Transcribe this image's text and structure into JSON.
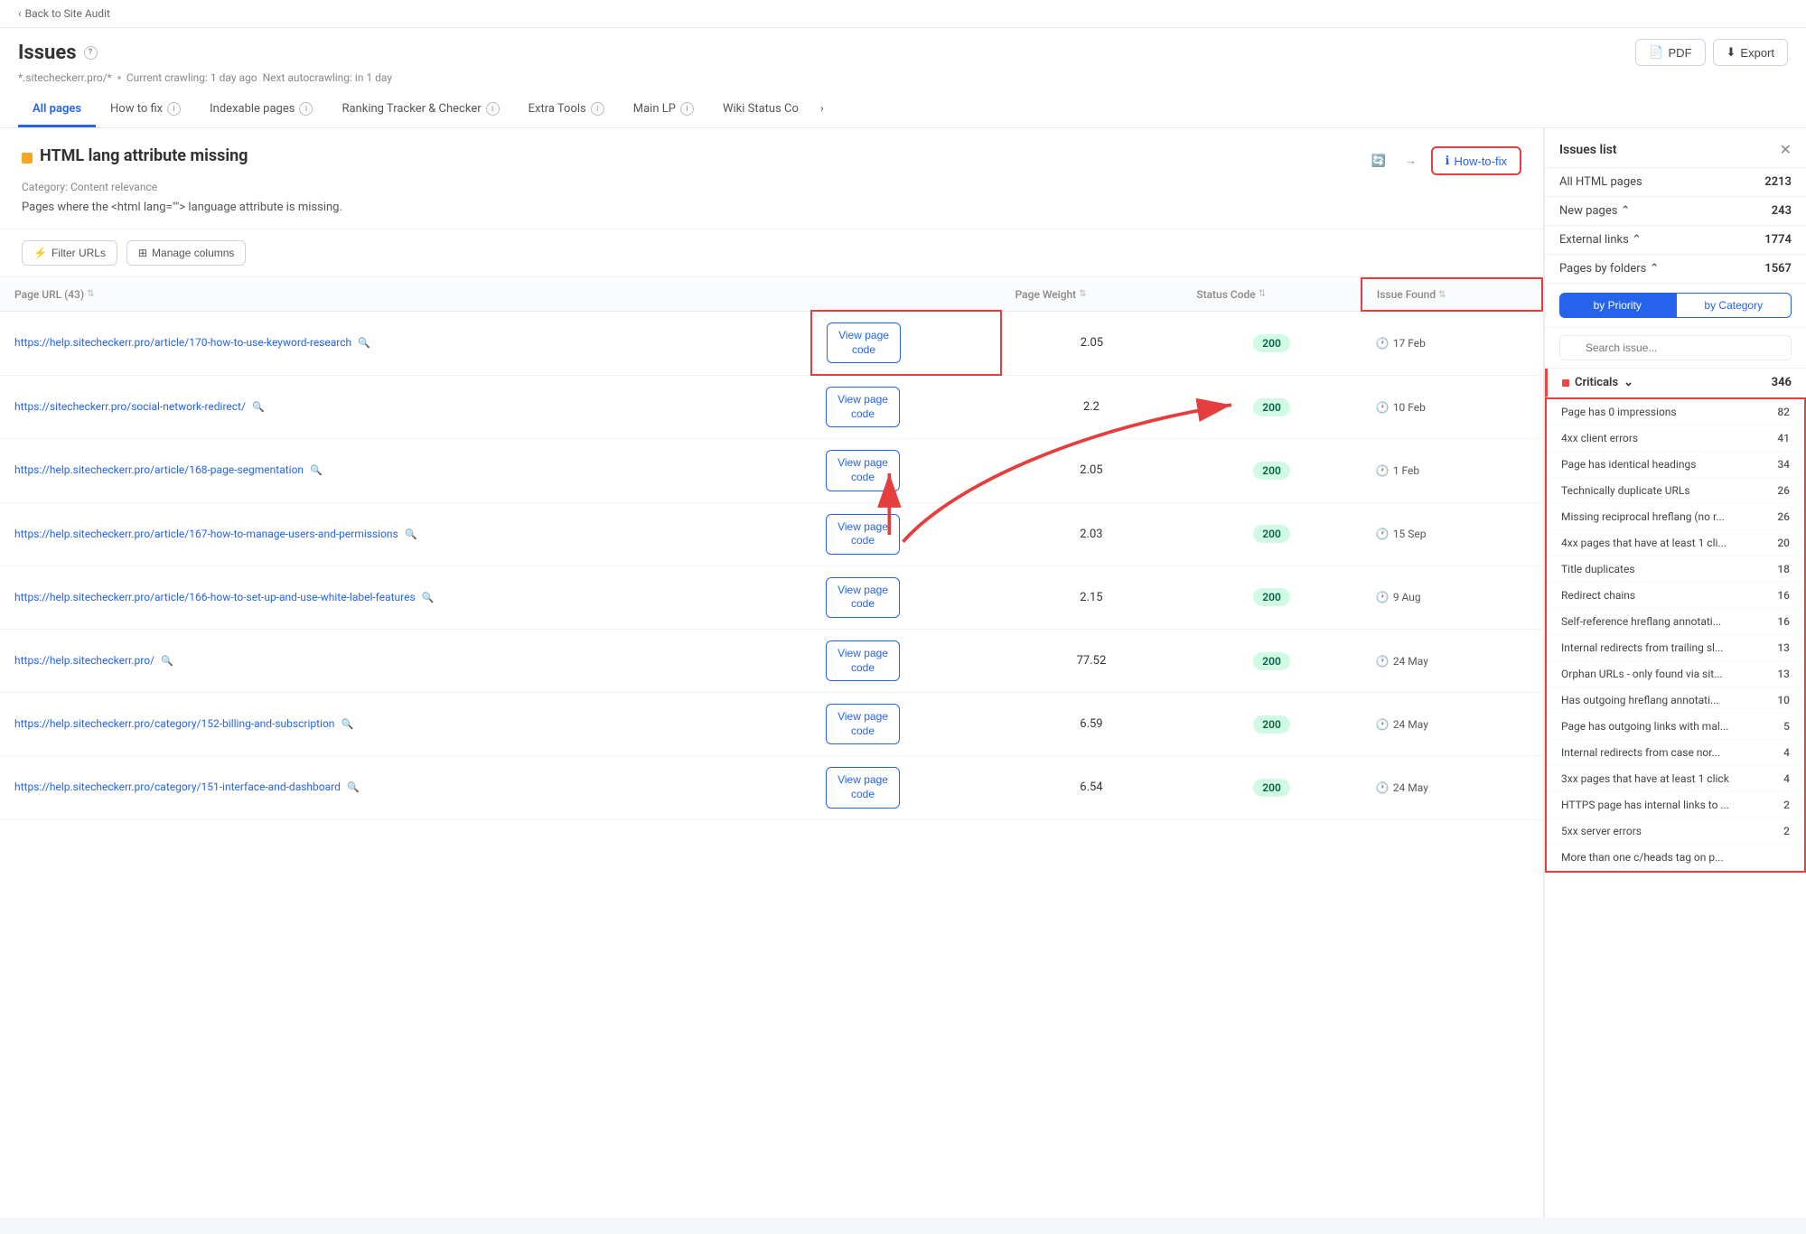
{
  "topbar": {
    "back_label": "Back to Site Audit"
  },
  "header": {
    "title": "Issues",
    "meta_site": "*.sitecheckerr.pro/*",
    "meta_crawling": "Current crawling: 1 day ago",
    "meta_autocrawling": "Next autocrawling: in 1 day",
    "pdf_label": "PDF",
    "export_label": "Export"
  },
  "tabs": [
    {
      "label": "All pages",
      "active": true,
      "has_info": false
    },
    {
      "label": "How to fix",
      "active": false,
      "has_info": true
    },
    {
      "label": "Indexable pages",
      "active": false,
      "has_info": true
    },
    {
      "label": "Ranking Tracker & Checker",
      "active": false,
      "has_info": true
    },
    {
      "label": "Extra Tools",
      "active": false,
      "has_info": true
    },
    {
      "label": "Main LP",
      "active": false,
      "has_info": true
    },
    {
      "label": "Wiki Status Co",
      "active": false,
      "has_info": false
    }
  ],
  "issue": {
    "title": "HTML lang attribute missing",
    "category": "Category: Content relevance",
    "description": "Pages where the <html lang=\"\"> language attribute is missing.",
    "how_to_fix_label": "How-to-fix"
  },
  "toolbar": {
    "filter_label": "Filter URLs",
    "columns_label": "Manage columns"
  },
  "table": {
    "columns": [
      {
        "label": "Page URL (43)",
        "sortable": true
      },
      {
        "label": "",
        "sortable": false
      },
      {
        "label": "Page Weight",
        "sortable": true
      },
      {
        "label": "Status Code",
        "sortable": true
      },
      {
        "label": "Issue Found",
        "sortable": true
      }
    ],
    "rows": [
      {
        "url": "https://help.sitecheckerr.pro/article/170-how-to-use-keyword-research",
        "btn_label": "View page\ncode",
        "weight": "2.05",
        "status": "200",
        "date": "17 Feb"
      },
      {
        "url": "https://sitecheckerr.pro/social-network-redirect/",
        "btn_label": "View page\ncode",
        "weight": "2.2",
        "status": "200",
        "date": "10 Feb"
      },
      {
        "url": "https://help.sitecheckerr.pro/article/168-page-segmentation",
        "btn_label": "View page\ncode",
        "weight": "2.05",
        "status": "200",
        "date": "1 Feb"
      },
      {
        "url": "https://help.sitecheckerr.pro/article/167-how-to-manage-users-and-permissions",
        "btn_label": "View page\ncode",
        "weight": "2.03",
        "status": "200",
        "date": "15 Sep"
      },
      {
        "url": "https://help.sitecheckerr.pro/article/166-how-to-set-up-and-use-white-label-features",
        "btn_label": "View page\ncode",
        "weight": "2.15",
        "status": "200",
        "date": "9 Aug"
      },
      {
        "url": "https://help.sitecheckerr.pro/",
        "btn_label": "View page\ncode",
        "weight": "77.52",
        "status": "200",
        "date": "24 May"
      },
      {
        "url": "https://help.sitecheckerr.pro/category/152-billing-and-subscription",
        "btn_label": "View page\ncode",
        "weight": "6.59",
        "status": "200",
        "date": "24 May"
      },
      {
        "url": "https://help.sitecheckerr.pro/category/151-interface-and-dashboard",
        "btn_label": "View page\ncode",
        "weight": "6.54",
        "status": "200",
        "date": "24 May"
      }
    ]
  },
  "right_panel": {
    "title": "Issues list",
    "all_pages_label": "All HTML pages",
    "all_pages_count": "2213",
    "new_pages_label": "New pages",
    "new_pages_count": "243",
    "external_links_label": "External links",
    "external_links_count": "1774",
    "pages_by_folders_label": "Pages by folders",
    "pages_by_folders_count": "1567",
    "by_priority_label": "by Priority",
    "by_category_label": "by Category",
    "search_placeholder": "Search issue...",
    "criticals_label": "Criticals",
    "criticals_count": "346",
    "issues": [
      {
        "label": "Page has 0 impressions",
        "count": "82"
      },
      {
        "label": "4xx client errors",
        "count": "41"
      },
      {
        "label": "Page has identical headings",
        "count": "34"
      },
      {
        "label": "Technically duplicate URLs",
        "count": "26"
      },
      {
        "label": "Missing reciprocal hreflang (no r...",
        "count": "26"
      },
      {
        "label": "4xx pages that have at least 1 cli...",
        "count": "20"
      },
      {
        "label": "Title duplicates",
        "count": "18"
      },
      {
        "label": "Redirect chains",
        "count": "16"
      },
      {
        "label": "Self-reference hreflang annotati...",
        "count": "16"
      },
      {
        "label": "Internal redirects from trailing sl...",
        "count": "13"
      },
      {
        "label": "Orphan URLs - only found via sit...",
        "count": "13"
      },
      {
        "label": "Has outgoing hreflang annotati...",
        "count": "10"
      },
      {
        "label": "Page has outgoing links with mal...",
        "count": "5"
      },
      {
        "label": "Internal redirects from case nor...",
        "count": "4"
      },
      {
        "label": "3xx pages that have at least 1 click",
        "count": "4"
      },
      {
        "label": "HTTPS page has internal links to ...",
        "count": "2"
      },
      {
        "label": "5xx server errors",
        "count": "2"
      },
      {
        "label": "More than one c/heads tag on p...",
        "count": ""
      }
    ]
  }
}
